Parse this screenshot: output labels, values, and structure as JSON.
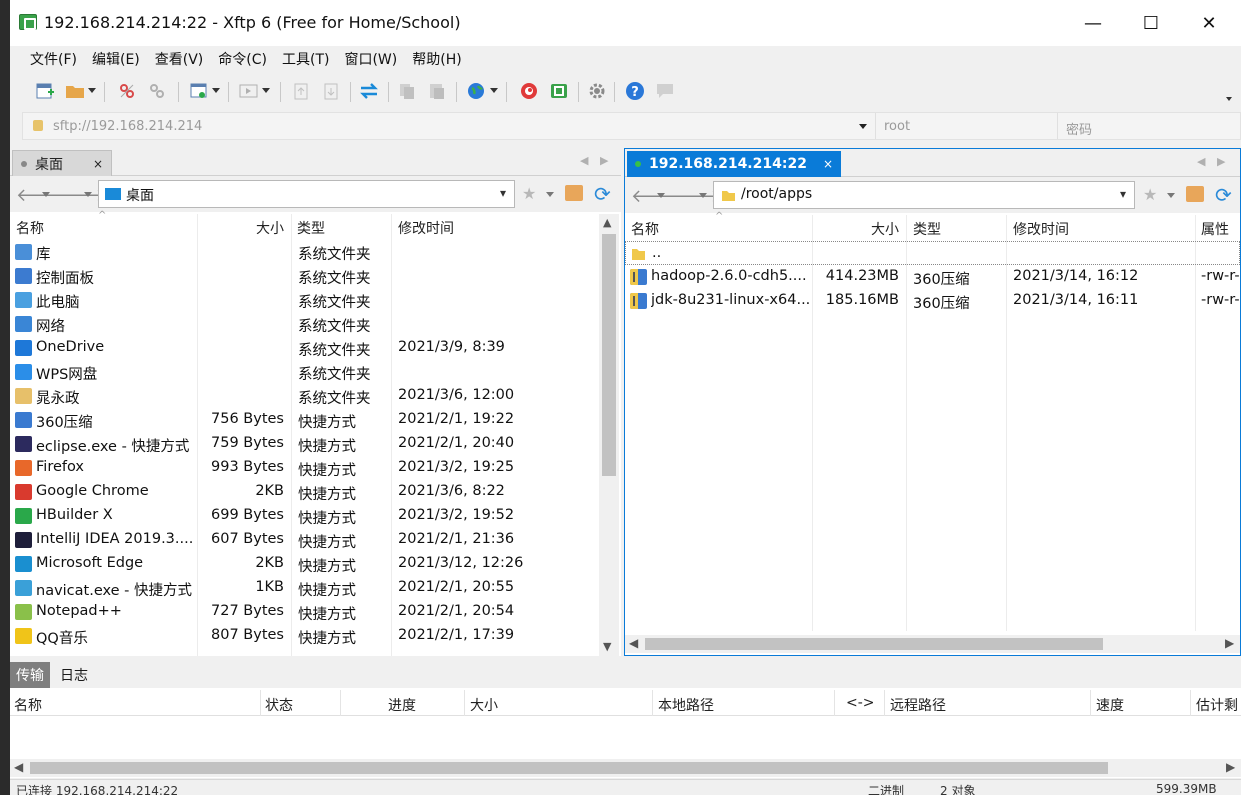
{
  "window": {
    "title": "192.168.214.214:22 - Xftp 6 (Free for Home/School)",
    "minimize_glyph": "—",
    "maximize_glyph": "☐",
    "close_glyph": "✕"
  },
  "menu": [
    "文件(F)",
    "编辑(E)",
    "查看(V)",
    "命令(C)",
    "工具(T)",
    "窗口(W)",
    "帮助(H)"
  ],
  "address": {
    "url_placeholder": "sftp://192.168.214.214",
    "user_placeholder": "root",
    "password_placeholder": "密码"
  },
  "local": {
    "tab_label": "桌面",
    "tab_close": "×",
    "path": "桌面",
    "headers": {
      "name": "名称",
      "size": "大小",
      "type": "类型",
      "modified": "修改时间"
    },
    "files": [
      {
        "name": "库",
        "size": "",
        "type": "系统文件夹",
        "modified": "",
        "icon": "library-icon",
        "color": "#4a8fd8"
      },
      {
        "name": "控制面板",
        "size": "",
        "type": "系统文件夹",
        "modified": "",
        "icon": "control-panel-icon",
        "color": "#3c7bd0"
      },
      {
        "name": "此电脑",
        "size": "",
        "type": "系统文件夹",
        "modified": "",
        "icon": "computer-icon",
        "color": "#4aa0e0"
      },
      {
        "name": "网络",
        "size": "",
        "type": "系统文件夹",
        "modified": "",
        "icon": "network-icon",
        "color": "#3a86d6"
      },
      {
        "name": "OneDrive",
        "size": "",
        "type": "系统文件夹",
        "modified": "2021/3/9, 8:39",
        "icon": "onedrive-icon",
        "color": "#1e78d8"
      },
      {
        "name": "WPS网盘",
        "size": "",
        "type": "系统文件夹",
        "modified": "",
        "icon": "wps-cloud-icon",
        "color": "#2b8ee8"
      },
      {
        "name": "晁永政",
        "size": "",
        "type": "系统文件夹",
        "modified": "2021/3/6, 12:00",
        "icon": "user-folder-icon",
        "color": "#e7c06a"
      },
      {
        "name": "360压缩",
        "size": "756 Bytes",
        "type": "快捷方式",
        "modified": "2021/2/1, 19:22",
        "icon": "360zip-icon",
        "color": "#3a7ad0"
      },
      {
        "name": "eclipse.exe - 快捷方式",
        "size": "759 Bytes",
        "type": "快捷方式",
        "modified": "2021/2/1, 20:40",
        "icon": "eclipse-icon",
        "color": "#2c2a5e"
      },
      {
        "name": "Firefox",
        "size": "993 Bytes",
        "type": "快捷方式",
        "modified": "2021/3/2, 19:25",
        "icon": "firefox-icon",
        "color": "#e8682a"
      },
      {
        "name": "Google Chrome",
        "size": "2KB",
        "type": "快捷方式",
        "modified": "2021/3/6, 8:22",
        "icon": "chrome-icon",
        "color": "#d93a2e"
      },
      {
        "name": "HBuilder X",
        "size": "699 Bytes",
        "type": "快捷方式",
        "modified": "2021/3/2, 19:52",
        "icon": "hbuilder-icon",
        "color": "#2aa84a"
      },
      {
        "name": "IntelliJ IDEA 2019.3....",
        "size": "607 Bytes",
        "type": "快捷方式",
        "modified": "2021/2/1, 21:36",
        "icon": "intellij-icon",
        "color": "#1e1e3a"
      },
      {
        "name": "Microsoft Edge",
        "size": "2KB",
        "type": "快捷方式",
        "modified": "2021/3/12, 12:26",
        "icon": "edge-icon",
        "color": "#1a8fd0"
      },
      {
        "name": "navicat.exe - 快捷方式",
        "size": "1KB",
        "type": "快捷方式",
        "modified": "2021/2/1, 20:55",
        "icon": "navicat-icon",
        "color": "#3aa0d8"
      },
      {
        "name": "Notepad++",
        "size": "727 Bytes",
        "type": "快捷方式",
        "modified": "2021/2/1, 20:54",
        "icon": "notepadpp-icon",
        "color": "#8ac04a"
      },
      {
        "name": "QQ音乐",
        "size": "807 Bytes",
        "type": "快捷方式",
        "modified": "2021/2/1, 17:39",
        "icon": "qqmusic-icon",
        "color": "#f0c419"
      }
    ]
  },
  "remote": {
    "tab_label": "192.168.214.214:22",
    "tab_close": "×",
    "path": "/root/apps",
    "headers": {
      "name": "名称",
      "size": "大小",
      "type": "类型",
      "modified": "修改时间",
      "attr": "属性"
    },
    "parent": "..",
    "files": [
      {
        "name": "hadoop-2.6.0-cdh5....",
        "size": "414.23MB",
        "type": "360压缩",
        "modified": "2021/3/14, 16:12",
        "attr": "-rw-r-",
        "icon": "archive-icon"
      },
      {
        "name": "jdk-8u231-linux-x64...",
        "size": "185.16MB",
        "type": "360压缩",
        "modified": "2021/3/14, 16:11",
        "attr": "-rw-r-",
        "icon": "archive-icon"
      }
    ]
  },
  "transfer": {
    "tabs": [
      "传输",
      "日志"
    ],
    "headers": [
      "名称",
      "状态",
      "进度",
      "大小",
      "本地路径",
      "<->",
      "远程路径",
      "速度",
      "估计剩"
    ]
  },
  "status": {
    "connection": "已连接 192.168.214.214:22",
    "mode": "二进制",
    "objects": "2 对象",
    "total": "599.39MB"
  },
  "colors": {
    "accent": "#0a7bd8",
    "tab_active_bg": "#0a7bd8",
    "transfer_tab_bg": "#7f7f7f"
  }
}
